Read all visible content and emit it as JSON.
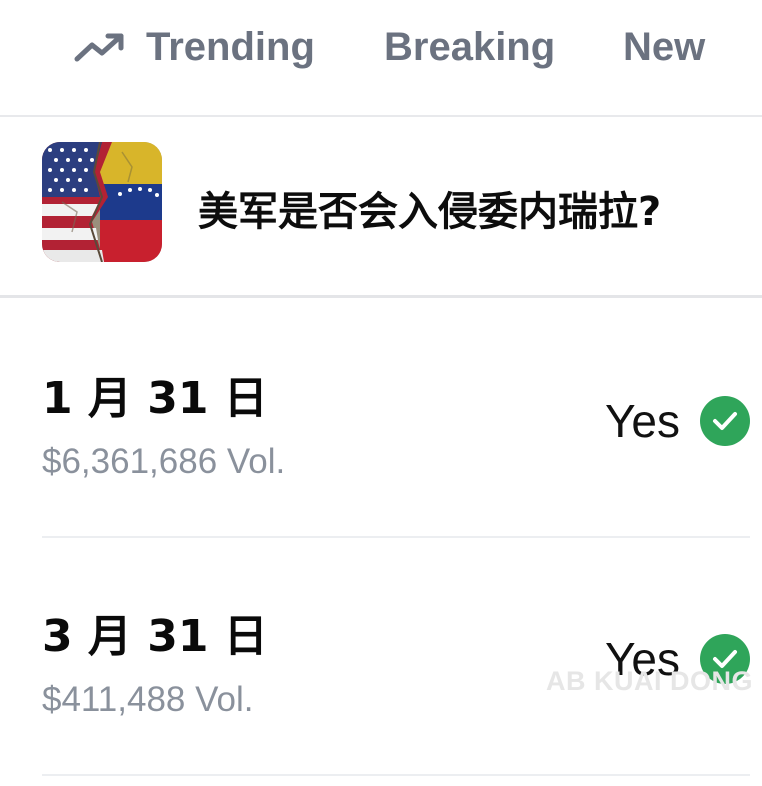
{
  "tabs": [
    {
      "label": "Trending",
      "icon": "trending-up-icon"
    },
    {
      "label": "Breaking"
    },
    {
      "label": "New"
    }
  ],
  "market": {
    "title": "美军是否会入侵委内瑞拉?"
  },
  "outcomes": [
    {
      "date": "1 月 31 日",
      "volume": "$6,361,686 Vol.",
      "result": "Yes",
      "result_icon": "check-circle-icon"
    },
    {
      "date": "3 月 31 日",
      "volume": "$411,488 Vol.",
      "result": "Yes",
      "result_icon": "check-circle-icon"
    }
  ],
  "watermark": "AB KUAI DONG",
  "colors": {
    "tab_text": "#6b7280",
    "check_green": "#2fa55a",
    "volume_text": "#8a919c"
  }
}
